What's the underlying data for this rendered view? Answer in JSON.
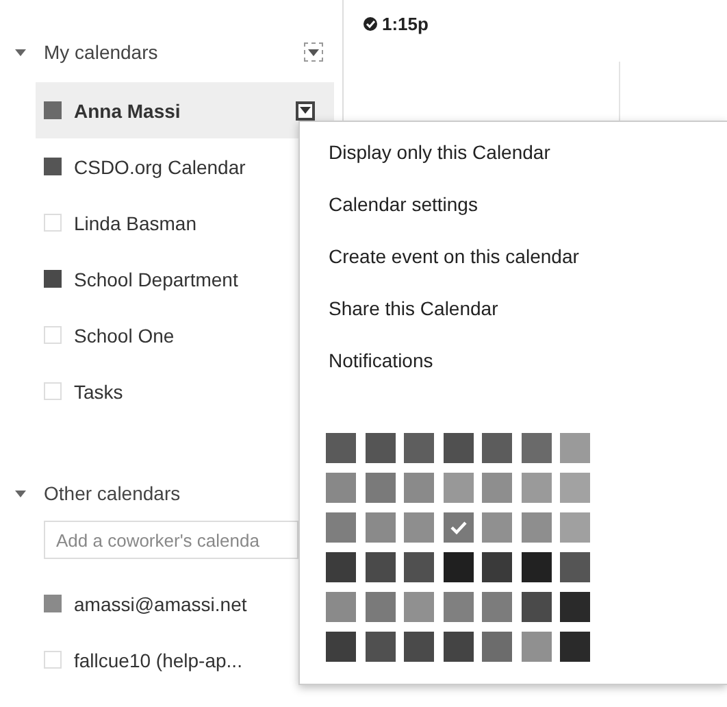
{
  "my_calendars": {
    "title": "My calendars",
    "expanded": true,
    "items": [
      {
        "name": "Anna Massi",
        "visible": true,
        "color": "#6a6a6a",
        "selected": true
      },
      {
        "name": "CSDO.org Calendar",
        "visible": true,
        "color": "#555555",
        "selected": false
      },
      {
        "name": "Linda Basman",
        "visible": false,
        "selected": false
      },
      {
        "name": "School Department",
        "visible": true,
        "color": "#4a4a4a",
        "selected": false
      },
      {
        "name": "School One",
        "visible": false,
        "selected": false
      },
      {
        "name": "Tasks",
        "visible": false,
        "selected": false
      }
    ]
  },
  "other_calendars": {
    "title": "Other calendars",
    "expanded": true,
    "add_field": {
      "placeholder": "Add a coworker's calenda"
    },
    "items": [
      {
        "name": "amassi@amassi.net",
        "visible": true,
        "color": "#8a8a8a",
        "selected": false
      },
      {
        "name": "fallcue10 (help-ap...",
        "visible": false,
        "selected": false
      }
    ]
  },
  "event": {
    "time": "1:15p"
  },
  "calendar_menu": {
    "items": [
      "Display only this Calendar",
      "Calendar settings",
      "Create event on this calendar",
      "Share this Calendar",
      "Notifications"
    ],
    "swatches": [
      [
        {
          "color": "#5a5a5a",
          "selected": false
        },
        {
          "color": "#555555",
          "selected": false
        },
        {
          "color": "#5e5e5e",
          "selected": false
        },
        {
          "color": "#505050",
          "selected": false
        },
        {
          "color": "#5c5c5c",
          "selected": false
        },
        {
          "color": "#6a6a6a",
          "selected": false
        },
        {
          "color": "#9a9a9a",
          "selected": false
        }
      ],
      [
        {
          "color": "#888888",
          "selected": false
        },
        {
          "color": "#7a7a7a",
          "selected": false
        },
        {
          "color": "#8a8a8a",
          "selected": false
        },
        {
          "color": "#989898",
          "selected": false
        },
        {
          "color": "#8e8e8e",
          "selected": false
        },
        {
          "color": "#9a9a9a",
          "selected": false
        },
        {
          "color": "#a2a2a2",
          "selected": false
        }
      ],
      [
        {
          "color": "#7e7e7e",
          "selected": false
        },
        {
          "color": "#8a8a8a",
          "selected": false
        },
        {
          "color": "#8e8e8e",
          "selected": false
        },
        {
          "color": "#7a7a7a",
          "selected": true
        },
        {
          "color": "#909090",
          "selected": false
        },
        {
          "color": "#8e8e8e",
          "selected": false
        },
        {
          "color": "#a0a0a0",
          "selected": false
        }
      ],
      [
        {
          "color": "#3c3c3c",
          "selected": false
        },
        {
          "color": "#4a4a4a",
          "selected": false
        },
        {
          "color": "#505050",
          "selected": false
        },
        {
          "color": "#202020",
          "selected": false
        },
        {
          "color": "#3a3a3a",
          "selected": false
        },
        {
          "color": "#222222",
          "selected": false
        },
        {
          "color": "#555555",
          "selected": false
        }
      ],
      [
        {
          "color": "#8a8a8a",
          "selected": false
        },
        {
          "color": "#7a7a7a",
          "selected": false
        },
        {
          "color": "#909090",
          "selected": false
        },
        {
          "color": "#808080",
          "selected": false
        },
        {
          "color": "#7c7c7c",
          "selected": false
        },
        {
          "color": "#4a4a4a",
          "selected": false
        },
        {
          "color": "#2a2a2a",
          "selected": false
        }
      ],
      [
        {
          "color": "#3e3e3e",
          "selected": false
        },
        {
          "color": "#505050",
          "selected": false
        },
        {
          "color": "#4a4a4a",
          "selected": false
        },
        {
          "color": "#444444",
          "selected": false
        },
        {
          "color": "#6c6c6c",
          "selected": false
        },
        {
          "color": "#909090",
          "selected": false
        },
        {
          "color": "#2a2a2a",
          "selected": false
        }
      ]
    ]
  }
}
